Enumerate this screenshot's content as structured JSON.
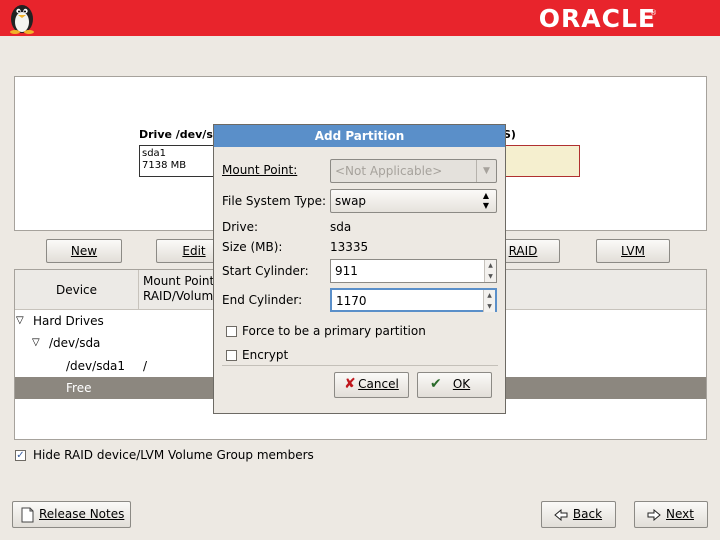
{
  "banner": {
    "logo": "ORACLE",
    "logo_mark": "®"
  },
  "drive": {
    "label": "Drive /dev/se",
    "label_tail": "S)",
    "segment_sda1_name": "sda1",
    "segment_sda1_size": "7138 MB"
  },
  "toolbar": {
    "new_label": "New",
    "edit_label": "Edit",
    "raid_label": "RAID",
    "lvm_label": "LVM"
  },
  "tree": {
    "col_device": "Device",
    "col_mount_line1": "Mount Point/",
    "col_mount_line2": "RAID/Volume",
    "rows": [
      {
        "device": "Hard Drives",
        "mount": ""
      },
      {
        "device": "/dev/sda",
        "mount": ""
      },
      {
        "device": "/dev/sda1",
        "mount": "/"
      },
      {
        "device": "Free",
        "mount": ""
      }
    ]
  },
  "hide_raid": {
    "label": "Hide RAID device/LVM Volume Group members",
    "checked": true
  },
  "footer": {
    "release_notes": "Release Notes",
    "back": "Back",
    "next": "Next"
  },
  "dialog": {
    "title": "Add Partition",
    "mount_point_label": "Mount Point:",
    "mount_point_value": "<Not Applicable>",
    "fs_type_label": "File System Type:",
    "fs_type_value": "swap",
    "drive_label": "Drive:",
    "drive_value": "sda",
    "size_label": "Size (MB):",
    "size_value": "13335",
    "start_cyl_label": "Start Cylinder:",
    "start_cyl_value": "911",
    "end_cyl_label": "End Cylinder:",
    "end_cyl_value": "1170",
    "primary_label": "Force to be a primary partition",
    "primary_checked": false,
    "encrypt_label": "Encrypt",
    "encrypt_checked": false,
    "cancel_label": "Cancel",
    "ok_label": "OK"
  }
}
